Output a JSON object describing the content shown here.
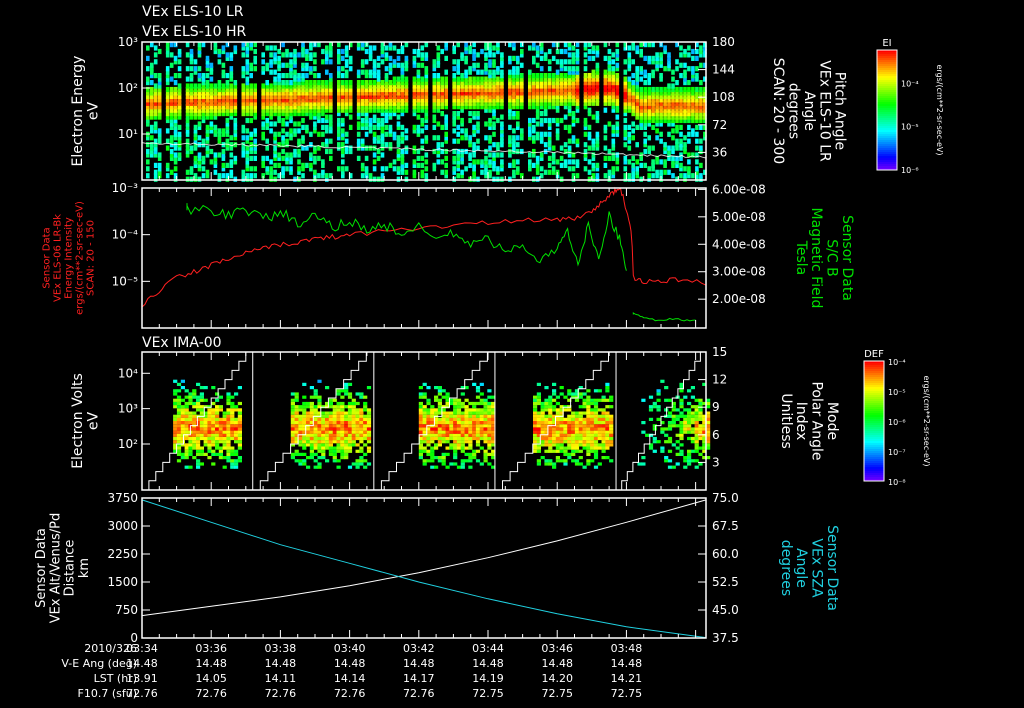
{
  "chart_data": [
    {
      "type": "heatmap",
      "titles": [
        "VEx ELS-10 LR",
        "VEx ELS-10 HR"
      ],
      "ylabel": [
        "Electron Energy",
        "eV"
      ],
      "yscale": "log",
      "ylim": [
        1,
        1000
      ],
      "yticks": [
        {
          "v": 10,
          "label": "10¹"
        },
        {
          "v": 100,
          "label": "10²"
        },
        {
          "v": 1000,
          "label": "10³"
        }
      ],
      "y2label": [
        "Pitch Angle",
        "VEx ELS-10 LR",
        "Angle",
        "degrees",
        "SCAN: 20 - 300"
      ],
      "y2lim": [
        0,
        180
      ],
      "y2ticks": [
        "36",
        "72",
        "108",
        "144",
        "180"
      ],
      "colorbar": {
        "title": "EI",
        "labels": [
          "10⁻⁴",
          "10⁻⁵",
          "10⁻⁶"
        ],
        "units": "ergs/(cm**2-sr-sec-eV)"
      },
      "band_center_ev": [
        {
          "t": 0,
          "v": 45
        },
        {
          "t": 4,
          "v": 55
        },
        {
          "t": 8,
          "v": 70
        },
        {
          "t": 12,
          "v": 85
        },
        {
          "t": 13.5,
          "v": 100
        },
        {
          "t": 14.3,
          "v": 40
        },
        {
          "t": 16.3,
          "v": 40
        }
      ],
      "pitch_angle_line": [
        {
          "t": 0,
          "v": 48
        },
        {
          "t": 4,
          "v": 45
        },
        {
          "t": 8,
          "v": 40
        },
        {
          "t": 12,
          "v": 36
        },
        {
          "t": 16.3,
          "v": 30
        }
      ]
    },
    {
      "type": "line",
      "ylabel": [
        "Sensor Data",
        "VEx ELS-06 LR-Bk",
        "Energy Intensity",
        "ergs/(cm**2-sr-sec-eV)",
        "SCAN: 20 - 150"
      ],
      "yscale": "log",
      "ylim": [
        1e-06,
        0.001
      ],
      "yticks": [
        {
          "v": 0.001,
          "label": "10⁻³"
        },
        {
          "v": 0.0001,
          "label": "10⁻⁴"
        },
        {
          "v": 1e-05,
          "label": "10⁻⁵"
        }
      ],
      "y2label": [
        "Sensor Data",
        "S/C B",
        "Magnetic Field",
        "Tesla"
      ],
      "y2lim": [
        9.5e-09,
        6.05e-08
      ],
      "y2ticks": [
        {
          "v": 6e-08,
          "label": "6.00e-08"
        },
        {
          "v": 5e-08,
          "label": "5.00e-08"
        },
        {
          "v": 4e-08,
          "label": "4.00e-08"
        },
        {
          "v": 3e-08,
          "label": "3.00e-08"
        },
        {
          "v": 2e-08,
          "label": "2.00e-08"
        }
      ],
      "series": [
        {
          "name": "ELS-06 Energy Intensity",
          "color": "#ff2020",
          "axis": "left",
          "points": [
            [
              0,
              3e-06
            ],
            [
              0.5,
              6e-06
            ],
            [
              1,
              1.2e-05
            ],
            [
              1.5,
              1.6e-05
            ],
            [
              2,
              2.2e-05
            ],
            [
              2.5,
              3e-05
            ],
            [
              3,
              4e-05
            ],
            [
              3.5,
              5e-05
            ],
            [
              4,
              6e-05
            ],
            [
              4.5,
              7e-05
            ],
            [
              5,
              8e-05
            ],
            [
              5.5,
              9e-05
            ],
            [
              6,
              0.0001
            ],
            [
              7,
              0.00012
            ],
            [
              8,
              0.00014
            ],
            [
              9,
              0.00016
            ],
            [
              10,
              0.00018
            ],
            [
              11,
              0.0002
            ],
            [
              12,
              0.00021
            ],
            [
              12.5,
              0.00023
            ],
            [
              13,
              0.0003
            ],
            [
              13.3,
              0.0005
            ],
            [
              13.6,
              0.0008
            ],
            [
              13.8,
              0.001
            ],
            [
              14,
              0.0003
            ],
            [
              14.2,
              1.2e-05
            ],
            [
              14.5,
              1e-05
            ],
            [
              15,
              1e-05
            ],
            [
              15.5,
              1.1e-05
            ],
            [
              16.3,
              9e-06
            ]
          ]
        },
        {
          "name": "S/C B",
          "color": "#00e000",
          "axis": "right",
          "points": [
            [
              1.3,
              5.3e-08
            ],
            [
              2,
              5.2e-08
            ],
            [
              2.5,
              5.1e-08
            ],
            [
              3,
              5.3e-08
            ],
            [
              3.5,
              4.9e-08
            ],
            [
              4,
              5.2e-08
            ],
            [
              4.5,
              4.7e-08
            ],
            [
              5,
              5e-08
            ],
            [
              5.5,
              4.6e-08
            ],
            [
              6,
              4.9e-08
            ],
            [
              6.5,
              4.5e-08
            ],
            [
              7,
              4.7e-08
            ],
            [
              7.5,
              4.4e-08
            ],
            [
              8,
              4.6e-08
            ],
            [
              8.5,
              4.2e-08
            ],
            [
              9,
              4.4e-08
            ],
            [
              9.5,
              4e-08
            ],
            [
              10,
              4.2e-08
            ],
            [
              10.5,
              3.7e-08
            ],
            [
              11,
              4e-08
            ],
            [
              11.5,
              3.4e-08
            ],
            [
              12,
              3.8e-08
            ],
            [
              12.3,
              4.5e-08
            ],
            [
              12.6,
              3.2e-08
            ],
            [
              12.9,
              4.8e-08
            ],
            [
              13.2,
              3.4e-08
            ],
            [
              13.5,
              5e-08
            ],
            [
              13.8,
              4.2e-08
            ],
            [
              14.0,
              3e-08
            ]
          ],
          "segment2": [
            [
              14.2,
              1.5e-08
            ],
            [
              14.5,
              1.3e-08
            ],
            [
              15,
              1.25e-08
            ],
            [
              15.5,
              1.25e-08
            ],
            [
              16,
              1.2e-08
            ]
          ]
        }
      ]
    },
    {
      "type": "heatmap",
      "title": "VEx IMA-00",
      "ylabel": [
        "Electron Volts",
        "eV"
      ],
      "yscale": "log",
      "ylim": [
        5,
        40000
      ],
      "yticks": [
        {
          "v": 100,
          "label": "10²"
        },
        {
          "v": 1000,
          "label": "10³"
        },
        {
          "v": 10000,
          "label": "10⁴"
        }
      ],
      "y2label": [
        "Mode",
        "Polar Angle",
        "Index",
        "Unitless"
      ],
      "y2lim": [
        0,
        15
      ],
      "y2ticks": [
        "3",
        "6",
        "9",
        "12",
        "15"
      ],
      "mode_boundaries_min": [
        3.2,
        6.7,
        10.2,
        13.7
      ],
      "colorbar": {
        "title": "DEF",
        "labels": [
          "10⁻⁴",
          "10⁻⁵",
          "10⁻⁶",
          "10⁻⁷",
          "10⁻⁸"
        ],
        "units": "ergs/(cm**2-sr-sec-eV)"
      }
    },
    {
      "type": "line",
      "ylabel": [
        "Sensor Data",
        "VEx Alt/Venus/Pd",
        "Distance",
        "km"
      ],
      "ylim": [
        0,
        3750
      ],
      "yticks": [
        "0",
        "750",
        "1500",
        "2250",
        "3000",
        "3750"
      ],
      "y2label": [
        "Sensor Data",
        "VEx SZA",
        "Angle",
        "degrees"
      ],
      "y2lim": [
        37.5,
        75
      ],
      "y2ticks": [
        "37.5",
        "45.0",
        "52.5",
        "60.0",
        "67.5",
        "75.0"
      ],
      "series": [
        {
          "name": "Altitude",
          "color": "#ffffff",
          "axis": "left",
          "points": [
            [
              0,
              600
            ],
            [
              2,
              850
            ],
            [
              4,
              1100
            ],
            [
              6,
              1400
            ],
            [
              8,
              1750
            ],
            [
              10,
              2150
            ],
            [
              12,
              2600
            ],
            [
              14,
              3100
            ],
            [
              16.3,
              3700
            ]
          ]
        },
        {
          "name": "SZA",
          "color": "#20d0e0",
          "axis": "right",
          "points": [
            [
              0,
              74.5
            ],
            [
              2,
              68.5
            ],
            [
              4,
              62.5
            ],
            [
              6,
              57.5
            ],
            [
              8,
              52.5
            ],
            [
              10,
              48
            ],
            [
              12,
              44
            ],
            [
              14,
              40.5
            ],
            [
              16.3,
              37.6
            ]
          ]
        }
      ]
    }
  ],
  "x_axis": {
    "xlim_minutes": [
      0,
      16.3
    ],
    "rows": [
      {
        "label": "2010/326",
        "values": [
          "03:34",
          "03:36",
          "03:38",
          "03:40",
          "03:42",
          "03:44",
          "03:46",
          "03:48"
        ]
      },
      {
        "label": "V-E Ang (deg)",
        "values": [
          "14.48",
          "14.48",
          "14.48",
          "14.48",
          "14.48",
          "14.48",
          "14.48",
          "14.48"
        ]
      },
      {
        "label": "LST (hr)",
        "values": [
          "13.91",
          "14.05",
          "14.11",
          "14.14",
          "14.17",
          "14.19",
          "14.20",
          "14.21"
        ]
      },
      {
        "label": "F10.7 (sfu)",
        "values": [
          "72.76",
          "72.76",
          "72.76",
          "72.76",
          "72.76",
          "72.75",
          "72.75",
          "72.75"
        ]
      }
    ]
  }
}
